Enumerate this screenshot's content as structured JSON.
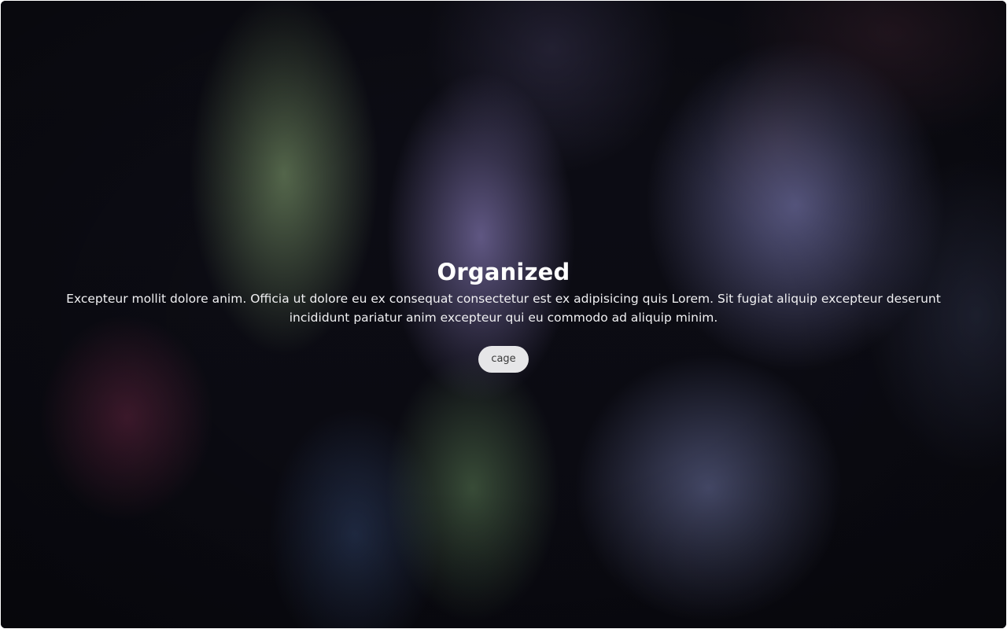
{
  "hero": {
    "title": "Organized",
    "description": "Excepteur mollit dolore anim. Officia ut dolore eu ex consequat consectetur est ex adipisicing quis Lorem. Sit fugiat aliquip excepteur deserunt incididunt pariatur anim excepteur qui eu commodo ad aliquip minim.",
    "button_label": "cage"
  },
  "colors": {
    "background": "#0b0b12",
    "text": "#ffffff",
    "button_bg": "#e6e6e8",
    "button_text": "#3a3a3a"
  }
}
